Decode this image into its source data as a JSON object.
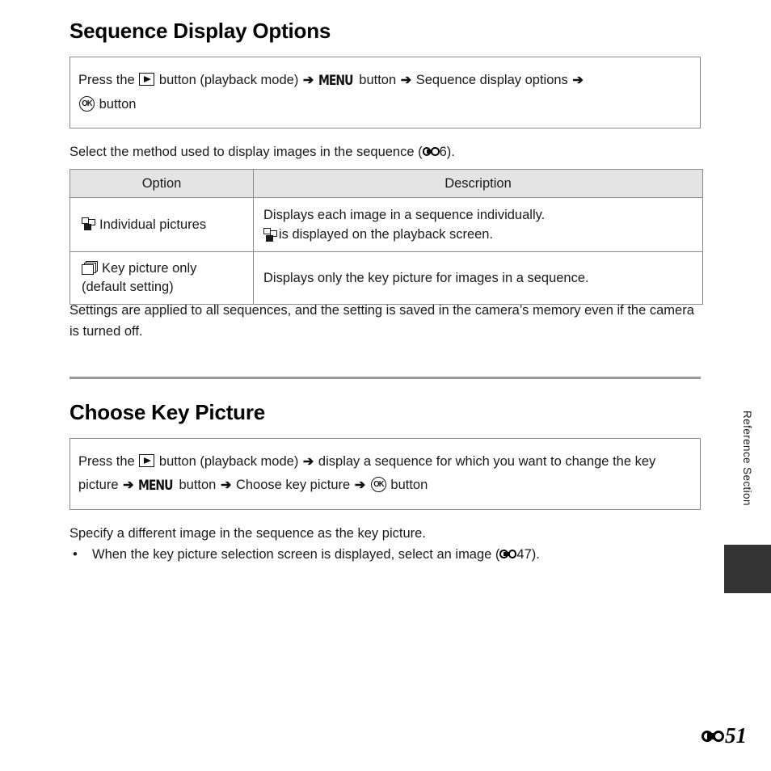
{
  "page": {
    "side_label": "Reference Section",
    "page_number": "51",
    "page_prefix_icon": "reference-mark-icon"
  },
  "sections": [
    {
      "id": "sequence-display-options",
      "title": "Sequence Display Options",
      "instruction": {
        "press_the": "Press the",
        "play_icon": "play-button-icon",
        "after_play": "button (playback mode)",
        "arrow": "➔",
        "menu_icon": "MENU",
        "menu_suffix": "button",
        "menu_target": "Sequence display options",
        "ok_icon": "OK",
        "ok_suffix": "button"
      },
      "intro_before": "Select the method used to display images in the sequence (",
      "intro_ref": "6",
      "intro_after": ").",
      "table": {
        "headers": [
          "Option",
          "Description"
        ],
        "rows": [
          {
            "icon": "individual-pictures-icon",
            "option": "Individual pictures",
            "option_sub": "",
            "description_line1": "Displays each image in a sequence individually.",
            "description_icon": "individual-pictures-icon",
            "description_line2": "is displayed on the playback screen."
          },
          {
            "icon": "key-picture-stack-icon",
            "option": "Key picture only",
            "option_sub": "(default setting)",
            "description_line1": "Displays only the key picture for images in a sequence.",
            "description_icon": "",
            "description_line2": ""
          }
        ]
      },
      "note": "Settings are applied to all sequences, and the setting is saved in the camera’s memory even if the camera is turned off."
    },
    {
      "id": "choose-key-picture",
      "title": "Choose Key Picture",
      "instruction": {
        "press_the": "Press the",
        "play_icon": "play-button-icon",
        "after_play": "button (playback mode)",
        "arrow": "➔",
        "step2": "display a sequence for which you want to change the key picture",
        "menu_icon": "MENU",
        "menu_suffix": "button",
        "menu_target": "Choose key picture",
        "ok_icon": "OK",
        "ok_suffix": "button"
      },
      "body": "Specify a different image in the sequence as the key picture.",
      "bullets": [
        {
          "bullet": "•",
          "text_before": "When the key picture selection screen is displayed, select an image (",
          "ref_page": "47",
          "text_after": ")."
        }
      ]
    }
  ],
  "colors": {
    "border": "#8c8c8c",
    "table_header_bg": "#e4e4e4",
    "divider": "#9a9a9a",
    "tab": "#333333",
    "text": "#1a1a1a"
  }
}
